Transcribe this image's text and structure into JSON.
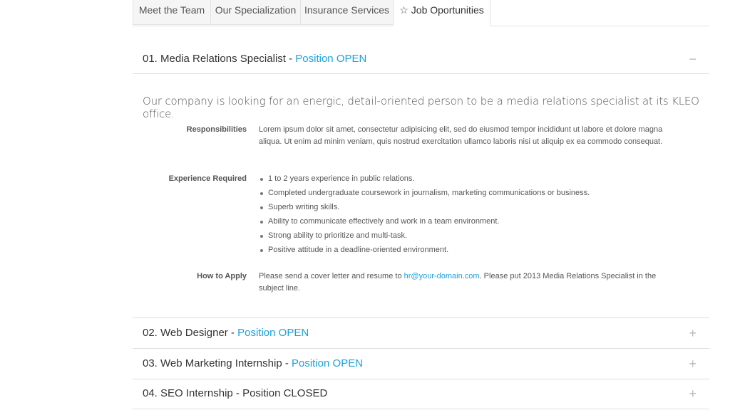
{
  "tabs": [
    {
      "label": "Meet the Team"
    },
    {
      "label": "Our Specialization"
    },
    {
      "label": "Insurance Services"
    },
    {
      "label": "Job Oportunities",
      "icon": "star-icon",
      "active": true
    }
  ],
  "jobs": [
    {
      "title": "01. Media Relations Specialist -",
      "status": "Position OPEN",
      "toggle": "−",
      "expanded": true
    },
    {
      "title": "02. Web Designer -",
      "status": "Position OPEN",
      "toggle": "+"
    },
    {
      "title": "03. Web Marketing Internship -",
      "status": "Position OPEN",
      "toggle": "+"
    },
    {
      "title": "04. SEO Internship - Position CLOSED",
      "status": "",
      "toggle": "+"
    }
  ],
  "detail": {
    "intro": "Our company is looking for an energic, detail-oriented person to be a media relations specialist at its KLEO office.",
    "responsibilities_label": "Responsibilities",
    "responsibilities_text": "Lorem ipsum dolor sit amet, consectetur adipisicing elit, sed do eiusmod tempor incididunt ut labore et dolore magna aliqua. Ut enim ad minim veniam, quis nostrud exercitation ullamco laboris nisi ut aliquip ex ea commodo consequat.",
    "experience_label": "Experience Required",
    "experience_items": [
      "1 to 2 years experience in public relations.",
      "Completed undergraduate coursework in journalism, marketing communications or business.",
      "Superb writing skills.",
      "Ability to communicate effectively and work in a team environment.",
      "Strong ability to prioritize and multi-task.",
      "Positive attitude in a deadline-oriented environment."
    ],
    "apply_label": "How to Apply",
    "apply_text_before": "Please send a cover letter and resume to ",
    "apply_email": "hr@your-domain.com",
    "apply_text_after": ". Please put 2013 Media Relations Specialist in the subject line."
  },
  "colors": {
    "accent": "#1da1db"
  }
}
